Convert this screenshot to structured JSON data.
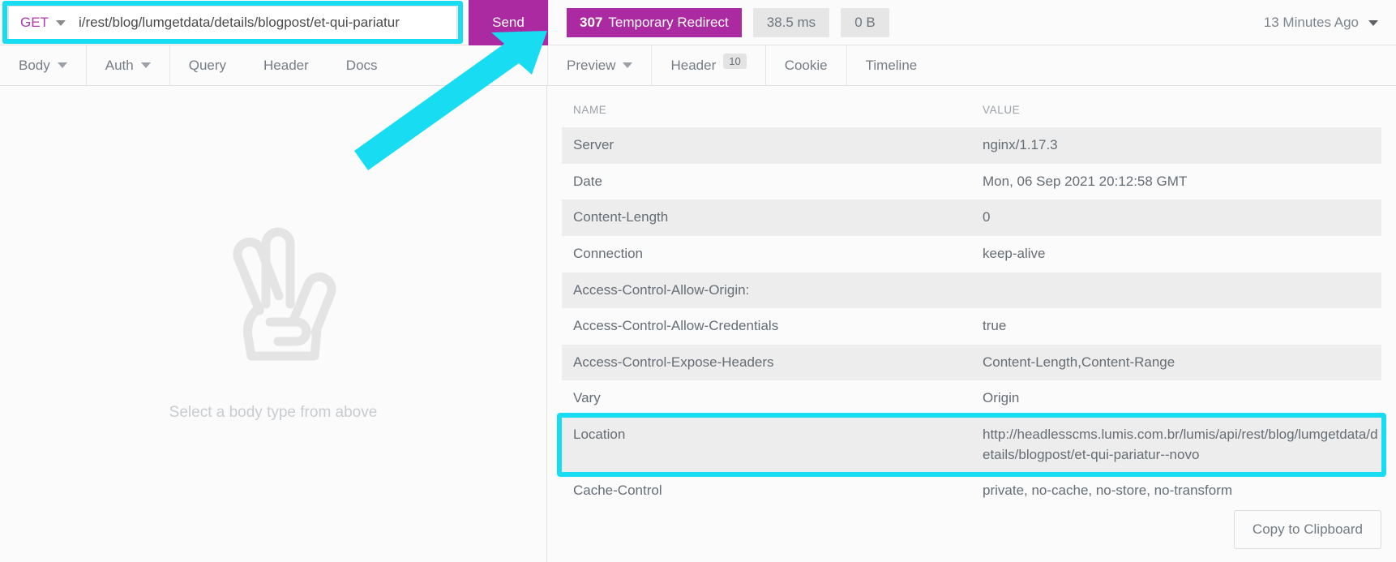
{
  "request": {
    "method": "GET",
    "url": "i/rest/blog/lumgetdata/details/blogpost/et-qui-pariatur",
    "send_label": "Send"
  },
  "response_status": {
    "code": "307",
    "text": "Temporary Redirect",
    "time": "38.5 ms",
    "size": "0 B",
    "time_ago": "13 Minutes Ago"
  },
  "request_tabs": [
    {
      "label": "Body",
      "has_caret": true
    },
    {
      "label": "Auth",
      "has_caret": true
    },
    {
      "label": "Query",
      "has_caret": false
    },
    {
      "label": "Header",
      "has_caret": false
    },
    {
      "label": "Docs",
      "has_caret": false
    }
  ],
  "response_tabs": [
    {
      "label": "Preview",
      "has_caret": true,
      "badge": ""
    },
    {
      "label": "Header",
      "has_caret": false,
      "badge": "10"
    },
    {
      "label": "Cookie",
      "has_caret": false,
      "badge": ""
    },
    {
      "label": "Timeline",
      "has_caret": false,
      "badge": ""
    }
  ],
  "request_body": {
    "empty_text": "Select a body type from above"
  },
  "headers_table": {
    "columns": [
      "NAME",
      "VALUE"
    ],
    "rows": [
      {
        "name": "Server",
        "value": "nginx/1.17.3",
        "link": false
      },
      {
        "name": "Date",
        "value": "Mon, 06 Sep 2021 20:12:58 GMT",
        "link": false
      },
      {
        "name": "Content-Length",
        "value": "0",
        "link": false
      },
      {
        "name": "Connection",
        "value": "keep-alive",
        "link": false
      },
      {
        "name": "Access-Control-Allow-Origin:",
        "value": "",
        "link": false
      },
      {
        "name": "Access-Control-Allow-Credentials",
        "value": "true",
        "link": false
      },
      {
        "name": "Access-Control-Expose-Headers",
        "value": "Content-Length,Content-Range",
        "link": false
      },
      {
        "name": "Vary",
        "value": "Origin",
        "link": false
      },
      {
        "name": "Location",
        "value": "http://headlesscms.lumis.com.br/lumis/api/rest/blog/lumgetdata/details/blogpost/et-qui-pariatur--novo",
        "link": true
      },
      {
        "name": "Cache-Control",
        "value": "private, no-cache, no-store, no-transform",
        "link": false
      }
    ]
  },
  "footer": {
    "copy_label": "Copy to Clipboard"
  },
  "annotation": {
    "color": "#18dcf2"
  }
}
